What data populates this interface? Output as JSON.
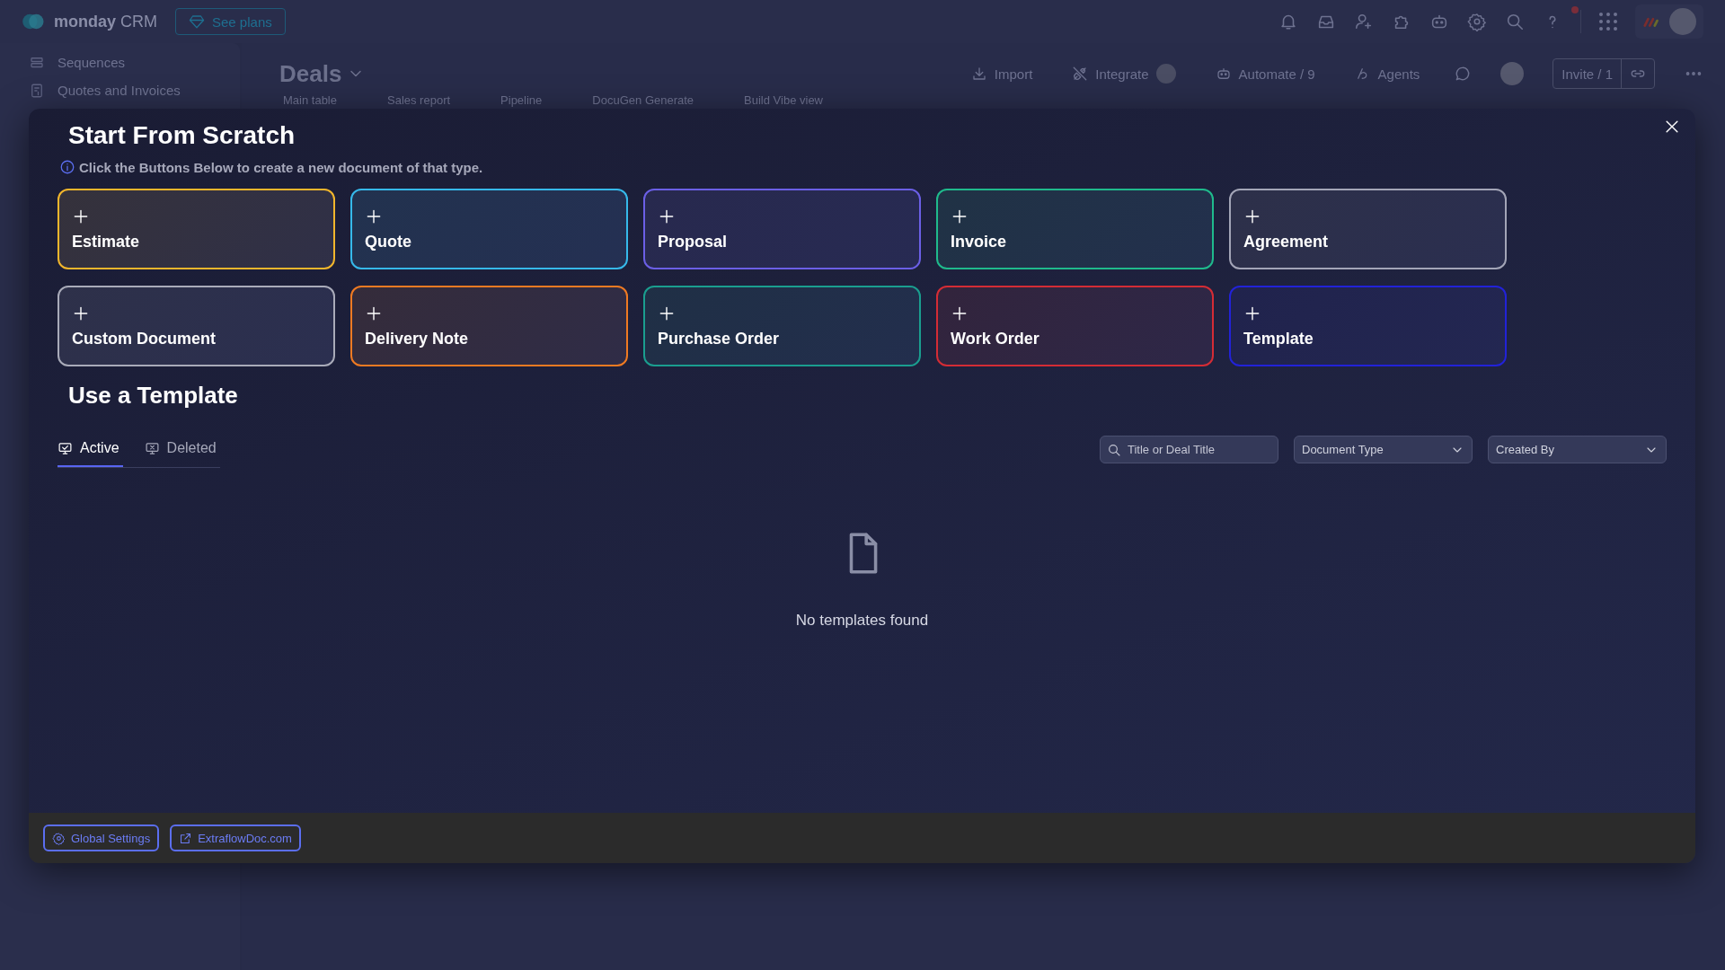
{
  "topbar": {
    "logo_bold": "monday",
    "logo_rest": "CRM",
    "plans_button": "See plans"
  },
  "sidebar": {
    "items": [
      {
        "label": "Sequences",
        "kind": "list"
      },
      {
        "label": "Quotes and Invoices",
        "kind": "invoice"
      }
    ]
  },
  "board": {
    "title": "Deals",
    "actions": [
      {
        "label": "Import",
        "kind": "import"
      },
      {
        "label": "Integrate",
        "kind": "integrate"
      },
      {
        "label": "Automate / 9",
        "kind": "automate"
      },
      {
        "label": "Agents",
        "kind": "agents"
      }
    ],
    "invite": "Invite / 1",
    "views": [
      "Main table",
      "Sales report",
      "Pipeline",
      "DocuGen Generate",
      "Build Vibe view"
    ]
  },
  "modal": {
    "title": "Start From Scratch",
    "hint": "Click the Buttons Below to create a new document of that type.",
    "doc_types": [
      {
        "label": "Estimate",
        "color": "#f2b62c"
      },
      {
        "label": "Quote",
        "color": "#36b9ea"
      },
      {
        "label": "Proposal",
        "color": "#6b5fe6"
      },
      {
        "label": "Invoice",
        "color": "#1fba8c"
      },
      {
        "label": "Agreement",
        "color": "#a3a5b7"
      },
      {
        "label": "Custom Document",
        "color": "#a9abb9"
      },
      {
        "label": "Delivery Note",
        "color": "#ef7a22"
      },
      {
        "label": "Purchase Order",
        "color": "#1a9e8f"
      },
      {
        "label": "Work Order",
        "color": "#d42c35"
      },
      {
        "label": "Template",
        "color": "#2222d8"
      }
    ],
    "template_title": "Use a Template",
    "tabs": [
      {
        "label": "Active",
        "selected": true
      },
      {
        "label": "Deleted",
        "selected": false
      }
    ],
    "search": {
      "placeholder": "Title or Deal Title"
    },
    "filters": [
      "Document Type",
      "Created By"
    ],
    "empty_text": "No templates found",
    "footer_buttons": [
      {
        "kind": "settings",
        "label": "Global Settings"
      },
      {
        "kind": "link",
        "label": "ExtraflowDoc.com"
      }
    ]
  }
}
